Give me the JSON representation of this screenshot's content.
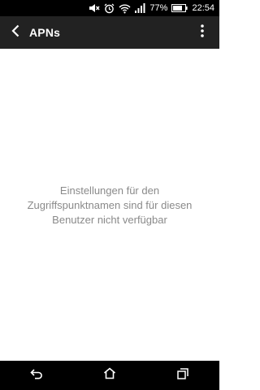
{
  "status_bar": {
    "battery_percent": "77%",
    "time": "22:54",
    "icons": [
      "mute-icon",
      "alarm-icon",
      "wifi-icon",
      "signal-icon",
      "battery-icon"
    ]
  },
  "app_bar": {
    "title": "APNs",
    "back_icon": "back-arrow-icon",
    "menu_icon": "overflow-menu-icon"
  },
  "main": {
    "message": "Einstellungen für den Zugriffspunktnamen sind für diesen Benutzer nicht verfügbar"
  },
  "nav_bar": {
    "buttons": [
      "back-icon",
      "home-icon",
      "recents-icon"
    ]
  },
  "colors": {
    "status_bar_bg": "#000000",
    "app_bar_bg": "#222222",
    "message_text": "#8a8a8a"
  }
}
